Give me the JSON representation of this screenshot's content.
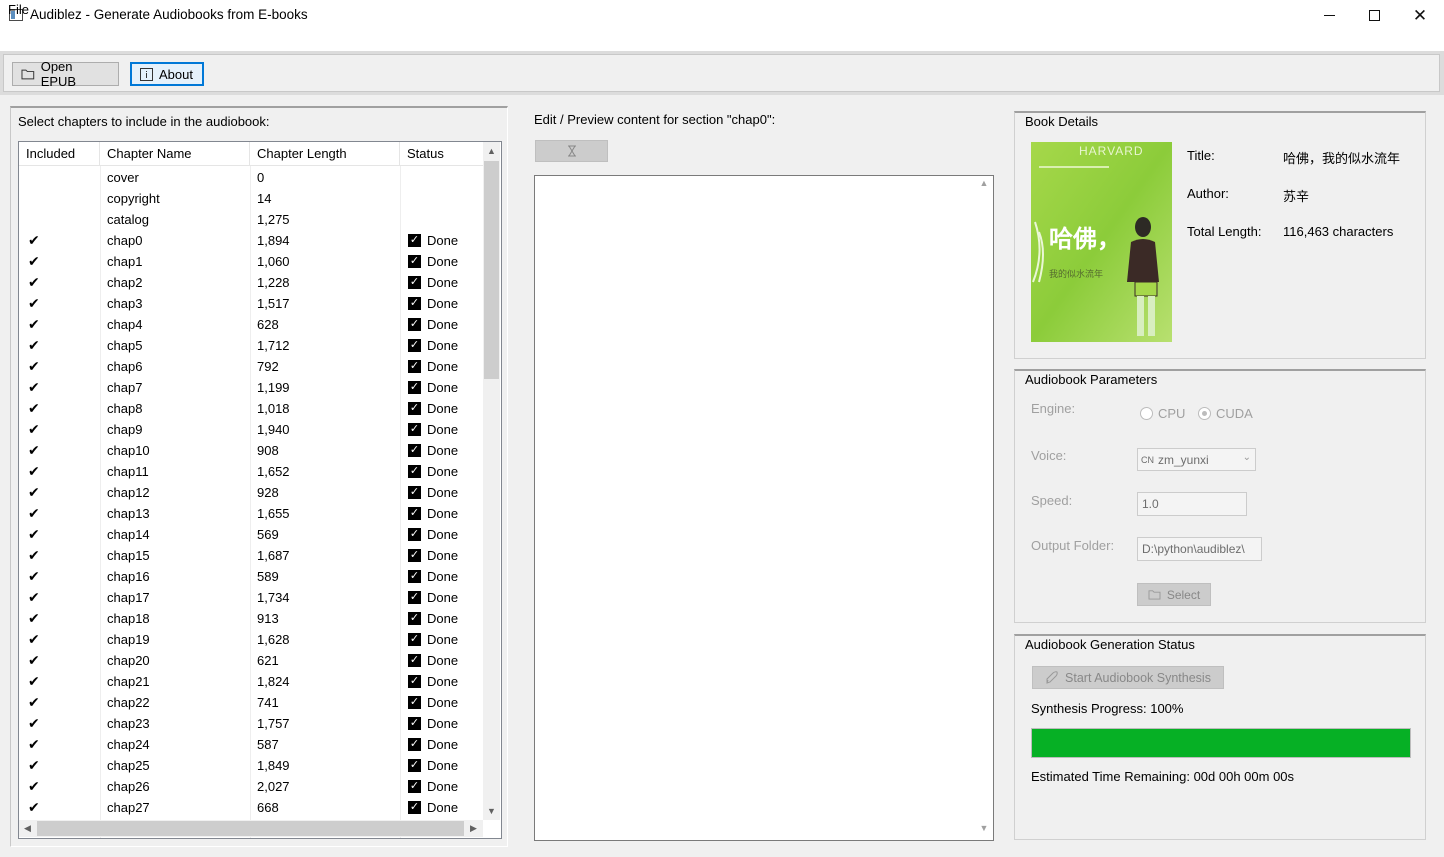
{
  "window": {
    "title": "Audiblez - Generate Audiobooks from E-books"
  },
  "menu": {
    "file": "File"
  },
  "toolbar": {
    "open_epub": "Open EPUB",
    "about": "About"
  },
  "chapters": {
    "label": "Select chapters to include in the audiobook:",
    "columns": [
      "Included",
      "Chapter Name",
      "Chapter Length",
      "Status"
    ],
    "rows": [
      {
        "included": false,
        "name": "cover",
        "length": "0",
        "status": ""
      },
      {
        "included": false,
        "name": "copyright",
        "length": "14",
        "status": ""
      },
      {
        "included": false,
        "name": "catalog",
        "length": "1,275",
        "status": ""
      },
      {
        "included": true,
        "name": "chap0",
        "length": "1,894",
        "status": "Done"
      },
      {
        "included": true,
        "name": "chap1",
        "length": "1,060",
        "status": "Done"
      },
      {
        "included": true,
        "name": "chap2",
        "length": "1,228",
        "status": "Done"
      },
      {
        "included": true,
        "name": "chap3",
        "length": "1,517",
        "status": "Done"
      },
      {
        "included": true,
        "name": "chap4",
        "length": "628",
        "status": "Done"
      },
      {
        "included": true,
        "name": "chap5",
        "length": "1,712",
        "status": "Done"
      },
      {
        "included": true,
        "name": "chap6",
        "length": "792",
        "status": "Done"
      },
      {
        "included": true,
        "name": "chap7",
        "length": "1,199",
        "status": "Done"
      },
      {
        "included": true,
        "name": "chap8",
        "length": "1,018",
        "status": "Done"
      },
      {
        "included": true,
        "name": "chap9",
        "length": "1,940",
        "status": "Done"
      },
      {
        "included": true,
        "name": "chap10",
        "length": "908",
        "status": "Done"
      },
      {
        "included": true,
        "name": "chap11",
        "length": "1,652",
        "status": "Done"
      },
      {
        "included": true,
        "name": "chap12",
        "length": "928",
        "status": "Done"
      },
      {
        "included": true,
        "name": "chap13",
        "length": "1,655",
        "status": "Done"
      },
      {
        "included": true,
        "name": "chap14",
        "length": "569",
        "status": "Done"
      },
      {
        "included": true,
        "name": "chap15",
        "length": "1,687",
        "status": "Done"
      },
      {
        "included": true,
        "name": "chap16",
        "length": "589",
        "status": "Done"
      },
      {
        "included": true,
        "name": "chap17",
        "length": "1,734",
        "status": "Done"
      },
      {
        "included": true,
        "name": "chap18",
        "length": "913",
        "status": "Done"
      },
      {
        "included": true,
        "name": "chap19",
        "length": "1,628",
        "status": "Done"
      },
      {
        "included": true,
        "name": "chap20",
        "length": "621",
        "status": "Done"
      },
      {
        "included": true,
        "name": "chap21",
        "length": "1,824",
        "status": "Done"
      },
      {
        "included": true,
        "name": "chap22",
        "length": "741",
        "status": "Done"
      },
      {
        "included": true,
        "name": "chap23",
        "length": "1,757",
        "status": "Done"
      },
      {
        "included": true,
        "name": "chap24",
        "length": "587",
        "status": "Done"
      },
      {
        "included": true,
        "name": "chap25",
        "length": "1,849",
        "status": "Done"
      },
      {
        "included": true,
        "name": "chap26",
        "length": "2,027",
        "status": "Done"
      },
      {
        "included": true,
        "name": "chap27",
        "length": "668",
        "status": "Done"
      }
    ]
  },
  "preview": {
    "label": "Edit / Preview content for section \"chap0\":",
    "content": ""
  },
  "book": {
    "group_title": "Book Details",
    "cover_text_top": "HARVARD",
    "cover_text_big": "哈佛，",
    "cover_text_sub": "我的似水流年",
    "title_label": "Title:",
    "title_value": "哈佛，我的似水流年",
    "author_label": "Author:",
    "author_value": "苏辛",
    "length_label": "Total Length:",
    "length_value": "116,463 characters"
  },
  "params": {
    "group_title": "Audiobook Parameters",
    "engine_label": "Engine:",
    "engine_options": [
      "CPU",
      "CUDA"
    ],
    "engine_selected": "CUDA",
    "voice_label": "Voice:",
    "voice_flag": "CN",
    "voice_value": "zm_yunxi",
    "speed_label": "Speed:",
    "speed_value": "1.0",
    "output_label": "Output Folder:",
    "output_value": "D:\\python\\audiblez\\",
    "select_button": "Select"
  },
  "generation": {
    "group_title": "Audiobook Generation Status",
    "start_button": "Start Audiobook Synthesis",
    "progress_label": "Synthesis Progress: 100%",
    "progress_value": 100,
    "eta_label": "Estimated Time Remaining: 00d 00h 00m 00s"
  },
  "colors": {
    "progress": "#06b025",
    "accent": "#0078d7"
  }
}
